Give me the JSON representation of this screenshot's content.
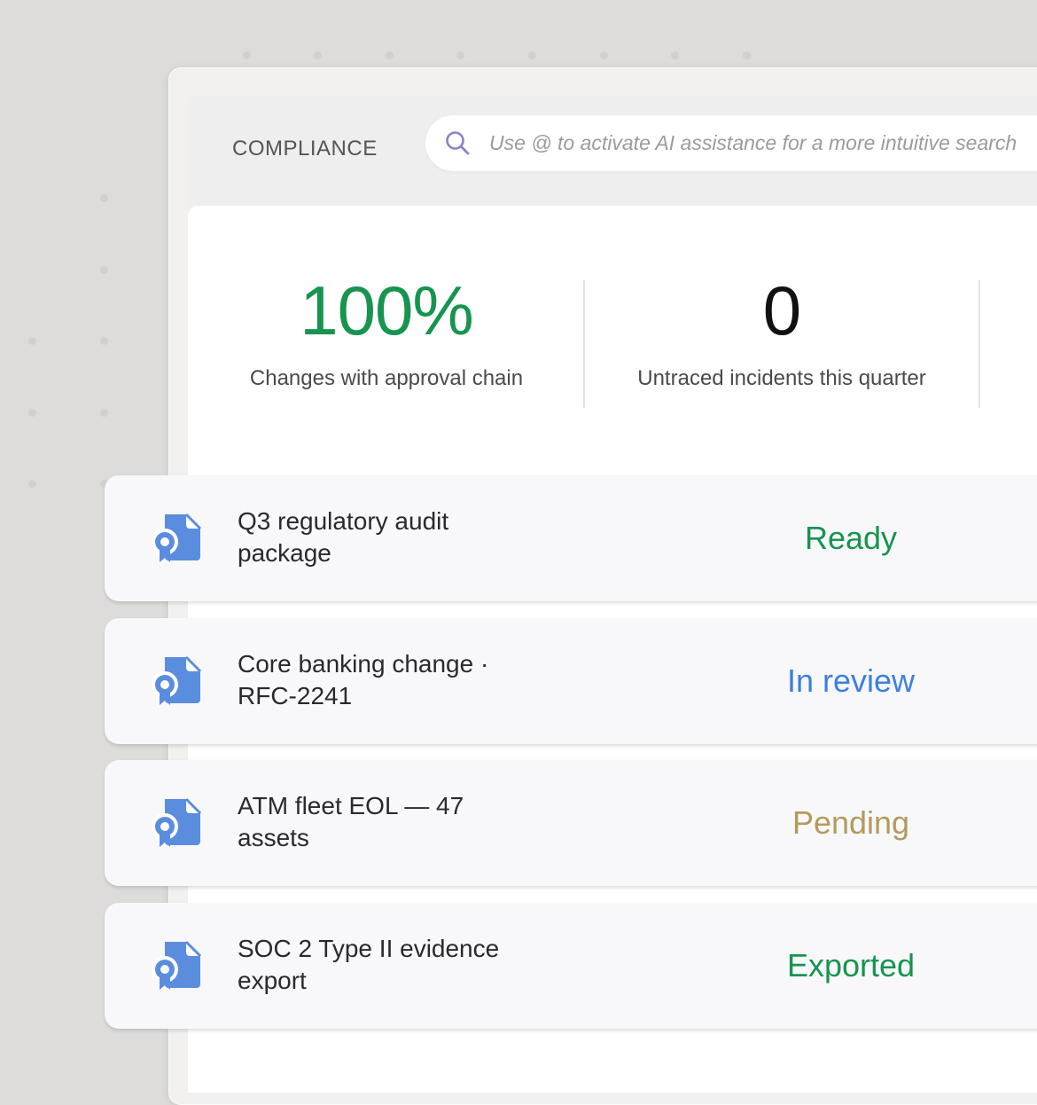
{
  "header": {
    "section_label": "COMPLIANCE",
    "search_placeholder": "Use @ to activate AI assistance for a more intuitive search",
    "search_icon": "search-icon"
  },
  "stats": [
    {
      "value": "100%",
      "label": "Changes with approval chain",
      "color": "#17944f"
    },
    {
      "value": "0",
      "label": "Untraced incidents this quarter",
      "color": "#111111"
    }
  ],
  "items": [
    {
      "icon": "certificate-document-icon",
      "title": "Q3 regulatory audit package",
      "status": "Ready",
      "status_color": "#17944f"
    },
    {
      "icon": "certificate-document-icon",
      "title": "Core banking change · RFC-2241",
      "status": "In review",
      "status_color": "#3d7fe0"
    },
    {
      "icon": "certificate-document-icon",
      "title": "ATM fleet EOL — 47 assets",
      "status": "Pending",
      "status_color": "#b39a5c"
    },
    {
      "icon": "certificate-document-icon",
      "title": "SOC 2 Type II evidence export",
      "status": "Exported",
      "status_color": "#17944f"
    }
  ],
  "colors": {
    "icon_blue": "#5b8ddf",
    "background": "#dddcda"
  }
}
